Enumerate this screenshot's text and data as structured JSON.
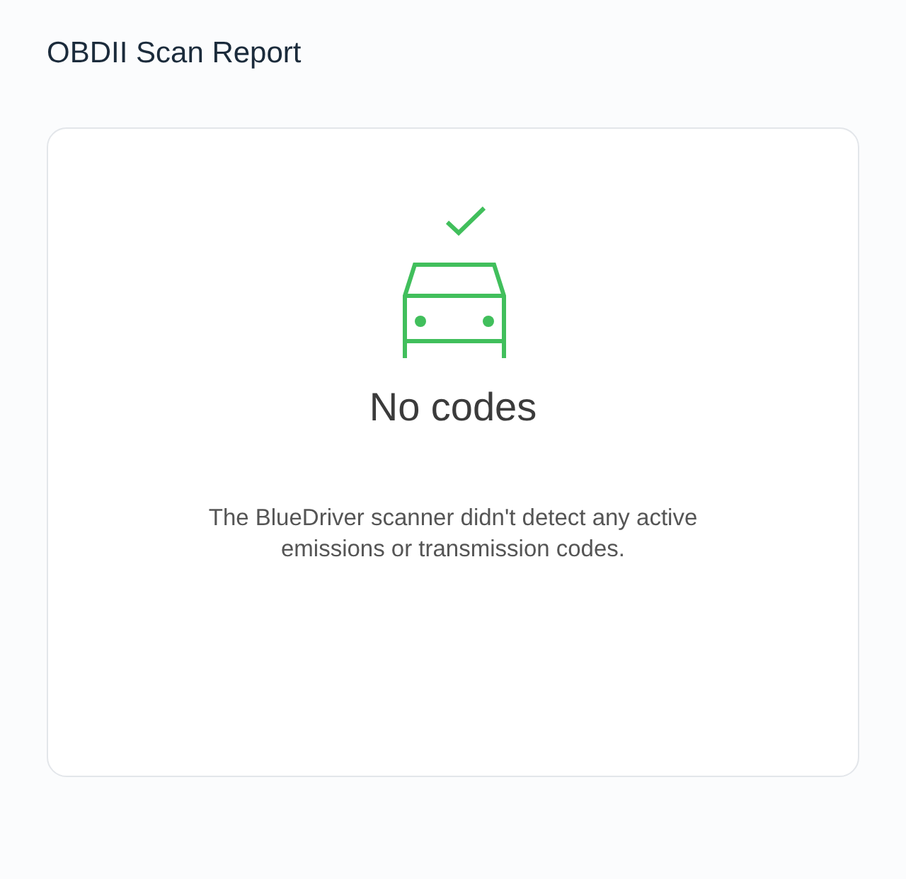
{
  "title": "OBDII Scan Report",
  "result": {
    "heading": "No codes",
    "message": "The BlueDriver scanner didn't detect any active emissions or transmission codes."
  }
}
